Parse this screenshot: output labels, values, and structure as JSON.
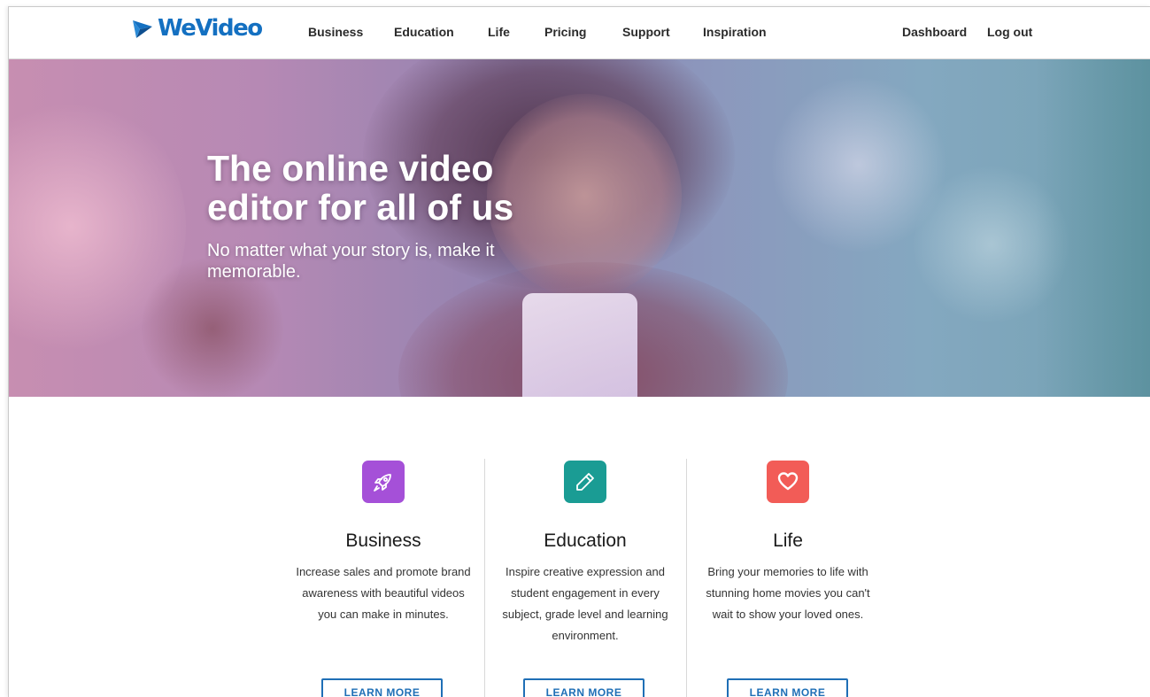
{
  "brand": {
    "logo_text": "WeVideo",
    "logo_icon": "play-arrow-icon",
    "color": "#1470c1"
  },
  "nav": {
    "items": [
      "Business",
      "Education",
      "Life",
      "Pricing",
      "Support",
      "Inspiration"
    ],
    "right": [
      "Dashboard",
      "Log out"
    ]
  },
  "hero": {
    "title": "The online video\neditor for all of us",
    "subtitle": "No matter what your story is, make it memorable."
  },
  "features": [
    {
      "title": "Business",
      "icon": "rocket-icon",
      "icon_color": "#a550d8",
      "description": "Increase sales and promote brand awareness with beautiful videos you can make in minutes.",
      "button": "LEARN MORE"
    },
    {
      "title": "Education",
      "icon": "pencil-icon",
      "icon_color": "#1a9c94",
      "description": "Inspire creative expression and student engagement in every subject, grade level and learning environment.",
      "button": "LEARN MORE"
    },
    {
      "title": "Life",
      "icon": "heart-icon",
      "icon_color": "#f25c57",
      "description": "Bring your memories to life with stunning home movies you can't wait to show your loved ones.",
      "button": "LEARN MORE"
    }
  ],
  "colors": {
    "accent": "#1f6fb6",
    "nav_text": "#2b2b2b"
  }
}
